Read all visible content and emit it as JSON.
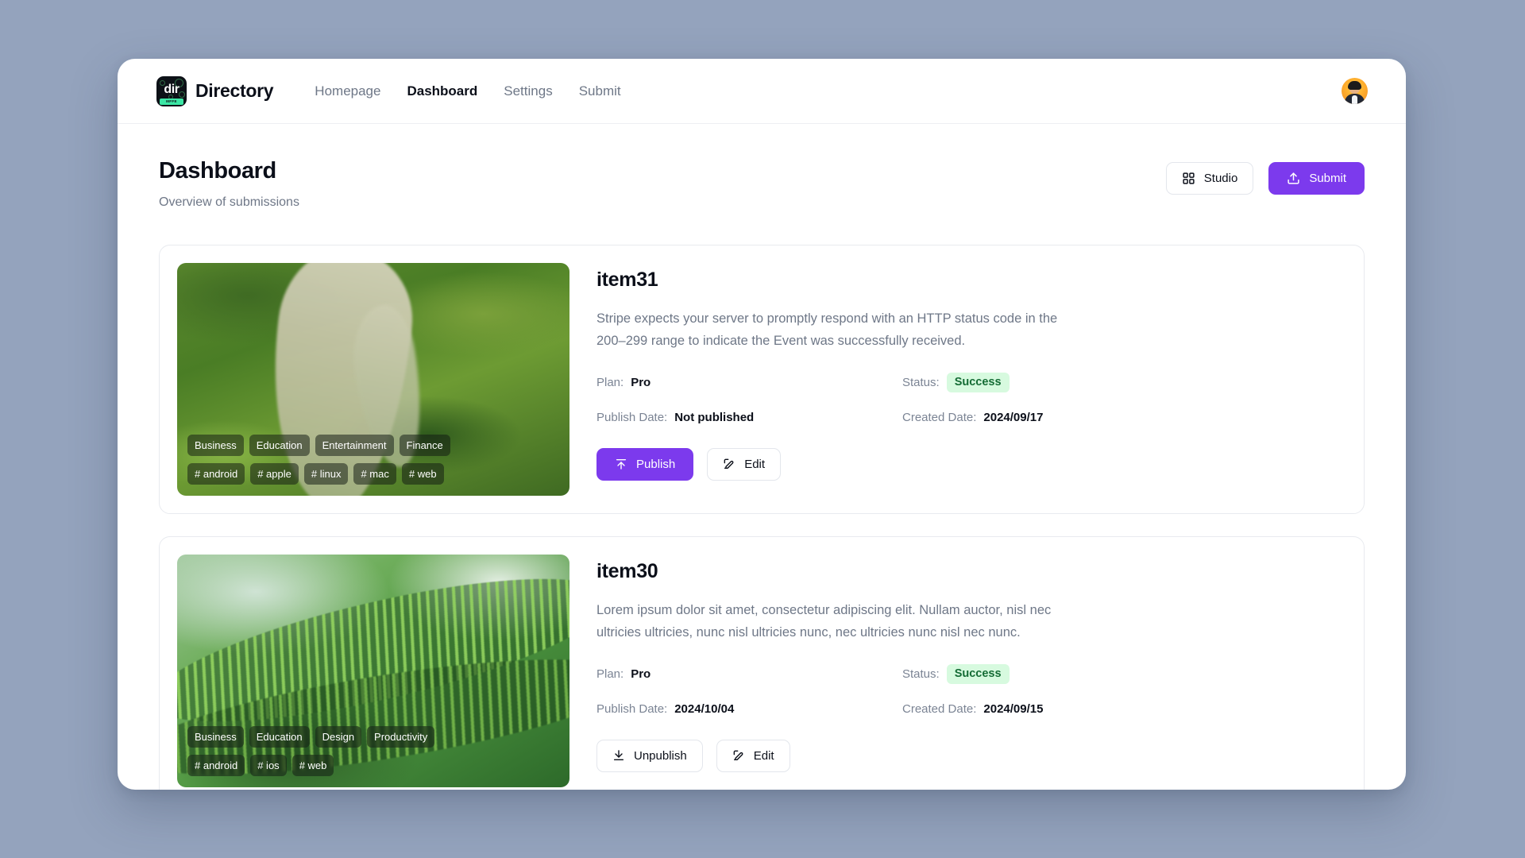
{
  "nav": {
    "logo_text": "dir",
    "logo_sub": "MFFE",
    "brand": "Directory",
    "links": [
      {
        "label": "Homepage",
        "active": false
      },
      {
        "label": "Dashboard",
        "active": true
      },
      {
        "label": "Settings",
        "active": false
      },
      {
        "label": "Submit",
        "active": false
      }
    ]
  },
  "header": {
    "title": "Dashboard",
    "subtitle": "Overview of submissions",
    "studio_label": "Studio",
    "submit_label": "Submit"
  },
  "labels": {
    "plan": "Plan:",
    "status": "Status:",
    "publish_date": "Publish Date:",
    "created_date": "Created Date:"
  },
  "colors": {
    "accent": "#7c3aed",
    "page_background": "#94a3bd",
    "surface": "#ffffff",
    "badge_success_bg": "#d7fadf",
    "badge_success_text": "#156c35",
    "muted_text": "#6e7787"
  },
  "cards": [
    {
      "title": "item31",
      "description": "Stripe expects your server to promptly respond with an HTTP status code in the 200–299 range to indicate the Event was successfully received.",
      "plan": "Pro",
      "status": "Success",
      "publish_date": "Not published",
      "created_date": "2024/09/17",
      "categories": [
        "Business",
        "Education",
        "Entertainment",
        "Finance"
      ],
      "hashtags": [
        "# android",
        "# apple",
        "# linux",
        "# mac",
        "# web"
      ],
      "primary_action": "Publish",
      "secondary_action": "Edit",
      "image": "aerial-forest-river"
    },
    {
      "title": "item30",
      "description": "Lorem ipsum dolor sit amet, consectetur adipiscing elit. Nullam auctor, nisl nec ultricies ultricies, nunc nisl ultricies nunc, nec ultricies nunc nisl nec nunc.",
      "plan": "Pro",
      "status": "Success",
      "publish_date": "2024/10/04",
      "created_date": "2024/09/15",
      "categories": [
        "Business",
        "Education",
        "Design",
        "Productivity"
      ],
      "hashtags": [
        "# android",
        "# ios",
        "# web"
      ],
      "primary_action": "Unpublish",
      "secondary_action": "Edit",
      "image": "green-fern-leaf"
    }
  ]
}
